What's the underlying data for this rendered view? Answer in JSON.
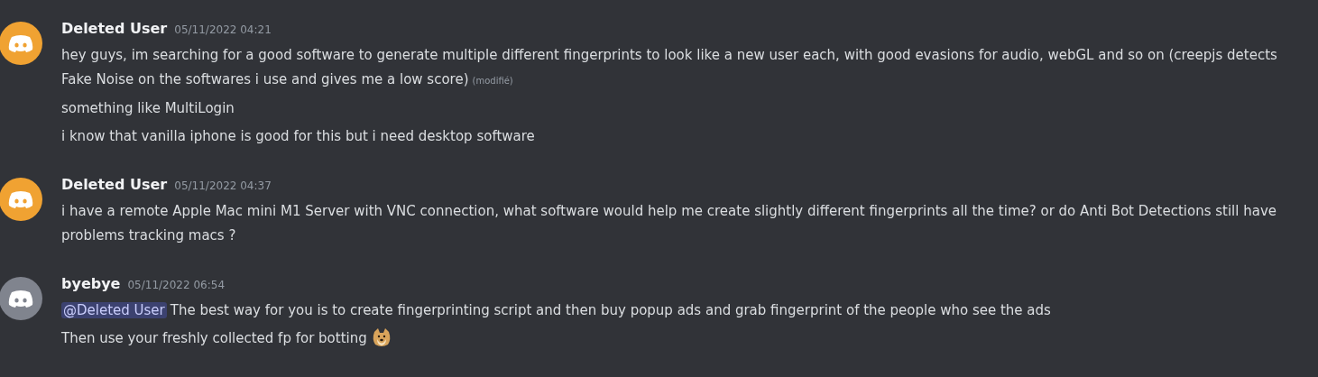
{
  "messages": [
    {
      "author": "Deleted User",
      "timestamp": "05/11/2022 04:21",
      "color": "#f0a232",
      "lines": [
        {
          "text": "hey guys, im searching for a good software to generate multiple different fingerprints to look like a new user each, with good evasions for audio, webGL and so on (creepjs detects Fake Noise on the softwares i use and gives me a low score)",
          "edited": "(modifié)"
        },
        {
          "text": "something like MultiLogin"
        },
        {
          "text": "i know that vanilla iphone is good for this but i need desktop software"
        }
      ]
    },
    {
      "author": "Deleted User",
      "timestamp": "05/11/2022 04:37",
      "color": "#f0a232",
      "lines": [
        {
          "text": "i have a remote Apple Mac mini M1 Server with VNC connection, what software would help me create slightly different fingerprints all the time? or do  Anti Bot Detections still have problems tracking macs ?"
        }
      ]
    },
    {
      "author": "byebye",
      "timestamp": "05/11/2022 06:54",
      "color": "#80848e",
      "lines": [
        {
          "mention": "@Deleted User",
          "text": "The best way for you is to create fingerprinting script and then buy popup ads and grab fingerprint of the people who see the ads"
        },
        {
          "text": "Then use your freshly collected fp for botting",
          "emoji": true
        }
      ]
    }
  ]
}
